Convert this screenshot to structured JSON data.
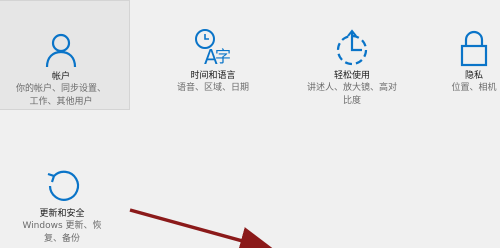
{
  "tiles": [
    {
      "title": "帐户",
      "desc": [
        "你的帐户、同步设置、",
        "工作、其他用户"
      ],
      "icon": "person-icon"
    },
    {
      "title": "时间和语言",
      "desc": [
        "语音、区域、日期"
      ],
      "icon": "time-language-icon"
    },
    {
      "title": "轻松使用",
      "desc": [
        "讲述人、放大镜、高对",
        "比度"
      ],
      "icon": "ease-of-access-icon"
    },
    {
      "title": "隐私",
      "desc": [
        "位置、相机"
      ],
      "icon": "lock-icon"
    },
    {
      "title": "更新和安全",
      "desc": [
        "Windows 更新、恢",
        "复、备份"
      ],
      "icon": "update-icon"
    }
  ],
  "colors": {
    "accent": "#0a74c8",
    "background": "#f0f0f0",
    "selected": "#e6e6e6",
    "arrow": "#8b1a1a"
  }
}
